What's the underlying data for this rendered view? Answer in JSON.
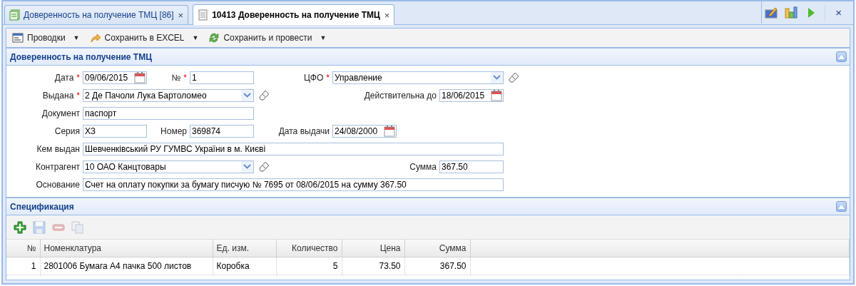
{
  "tabs": [
    {
      "label": "Доверенность на получение ТМЦ [86]",
      "selected": false,
      "close": "×"
    },
    {
      "label": "10413 Доверенность на получение ТМЦ",
      "selected": true,
      "close": "×"
    }
  ],
  "window_close": "×",
  "toolbar": [
    {
      "label": "Проводки",
      "caret": "▼"
    },
    {
      "label": "Сохранить в EXCEL",
      "caret": "▼"
    },
    {
      "label": "Сохранить и провести",
      "caret": "▼"
    }
  ],
  "form_panel": {
    "title": "Доверенность на получение ТМЦ",
    "fields": [
      {
        "label": "Дата",
        "required_mark": "*",
        "kind": "date",
        "value": "09/06/2015"
      },
      {
        "label": "№",
        "required_mark": "*",
        "kind": "text",
        "value": "1"
      },
      {
        "label": "ЦФО",
        "required_mark": "*",
        "kind": "combo",
        "value": "Управление",
        "clearable": true
      },
      {
        "label": "Выдана",
        "required_mark": "*",
        "kind": "combo",
        "value": "2 Де Пачоли Лука Бартоломео",
        "clearable": true
      },
      {
        "label": "Действительна до",
        "kind": "date",
        "value": "18/06/2015"
      },
      {
        "label": "Документ",
        "kind": "text",
        "value": "паспорт"
      },
      {
        "label": "Серия",
        "kind": "text",
        "value": "ХЗ"
      },
      {
        "label": "Номер",
        "kind": "text",
        "value": "369874"
      },
      {
        "label": "Дата выдачи",
        "kind": "date",
        "value": "24/08/2000"
      },
      {
        "label": "Кем выдан",
        "kind": "text",
        "value": "Шевченківський РУ ГУМВС України в м. Києві"
      },
      {
        "label": "Контрагент",
        "kind": "combo",
        "value": "10 ОАО Канцтовары",
        "clearable": true
      },
      {
        "label": "Сумма",
        "kind": "text",
        "value": "367.50"
      },
      {
        "label": "Основание",
        "kind": "text",
        "value": "Счет на оплату покупки за бумагу писчую № 7695 от 08/06/2015 на сумму 367.50"
      }
    ]
  },
  "spec_panel": {
    "title": "Спецификация",
    "tools": [
      {
        "disabled": false
      },
      {
        "disabled": true
      },
      {
        "disabled": true
      },
      {
        "disabled": true
      }
    ],
    "table": {
      "columns": [
        "№",
        "Номенклатура",
        "Ед. изм.",
        "Количество",
        "Цена",
        "Сумма"
      ],
      "rows": [
        [
          "1",
          "2801006 Бумага А4 пачка 500 листов",
          "Коробка",
          "5",
          "73.50",
          "367.50"
        ]
      ]
    }
  }
}
